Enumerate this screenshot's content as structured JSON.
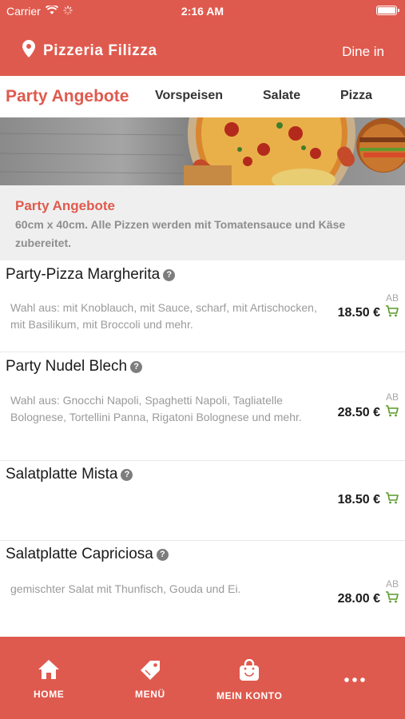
{
  "status_bar": {
    "carrier": "Carrier",
    "time": "2:16 AM"
  },
  "header": {
    "restaurant_name": "Pizzeria Filizza",
    "mode": "Dine in"
  },
  "tabs": [
    {
      "label": "Party Angebote",
      "active": true
    },
    {
      "label": "Vorspeisen",
      "active": false
    },
    {
      "label": "Salate",
      "active": false
    },
    {
      "label": "Pizza",
      "active": false
    }
  ],
  "category": {
    "title": "Party Angebote",
    "description": "60cm x 40cm. Alle Pizzen werden mit Tomatensauce und Käse zubereitet."
  },
  "items": [
    {
      "name": "Party-Pizza Margherita",
      "description": "Wahl aus: mit Knoblauch, mit Sauce, scharf, mit Artischocken, mit Basilikum, mit Broccoli und mehr.",
      "ab": "AB",
      "price": "18.50 €"
    },
    {
      "name": "Party Nudel Blech",
      "description": "Wahl aus: Gnocchi Napoli, Spaghetti Napoli, Tagliatelle Bolognese, Tortellini Panna, Rigatoni Bolognese und mehr.",
      "ab": "AB",
      "price": "28.50 €"
    },
    {
      "name": "Salatplatte Mista",
      "description": "",
      "ab": "",
      "price": "18.50 €"
    },
    {
      "name": "Salatplatte Capriciosa",
      "description": "gemischter Salat mit Thunfisch, Gouda und Ei.",
      "ab": "AB",
      "price": "28.00 €"
    }
  ],
  "bottom_nav": [
    {
      "label": "HOME",
      "icon": "home-icon"
    },
    {
      "label": "MENÜ",
      "icon": "tag-icon"
    },
    {
      "label": "MEIN KONTO",
      "icon": "bag-icon"
    },
    {
      "label": "",
      "icon": "more-icon"
    }
  ],
  "colors": {
    "brand": "#df5a4e",
    "cart": "#5a9a2a"
  }
}
